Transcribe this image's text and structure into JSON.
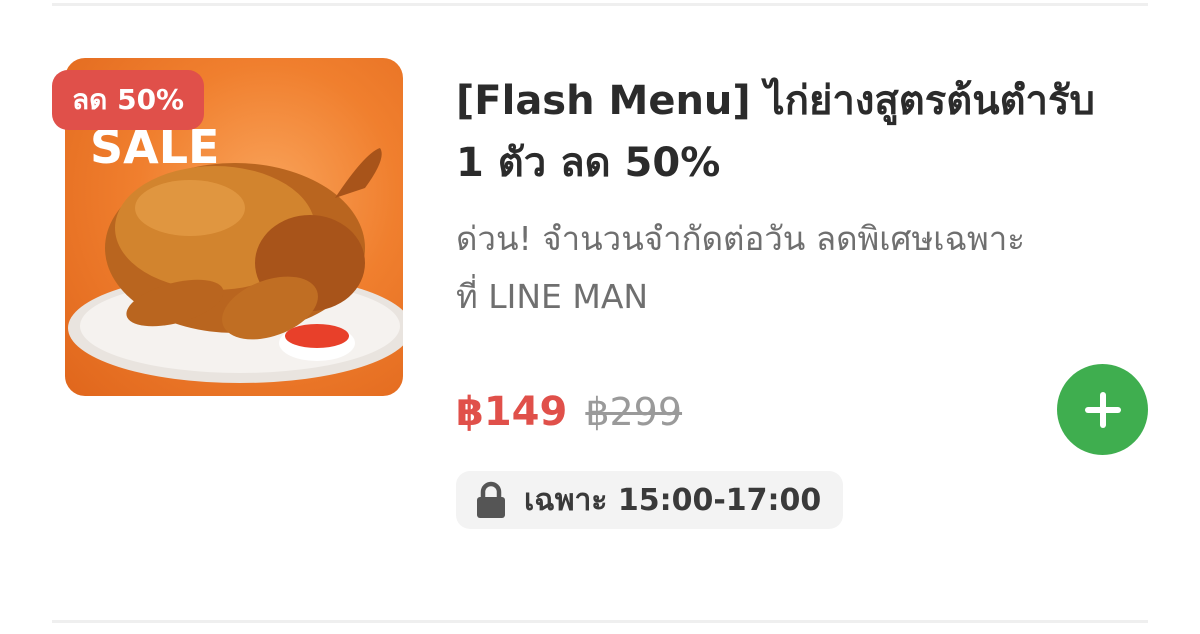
{
  "menu_item": {
    "discount_badge": "ลด 50%",
    "title_line1": "[Flash Menu] ไก่ย่างสูตรต้นตำรับ",
    "title_line2": "1 ตัว ลด 50%",
    "description_line1": "ด่วน! จำนวนจำกัดต่อวัน ลดพิเศษเฉพาะ",
    "description_line2": "ที่ LINE MAN",
    "price_current": "฿149",
    "price_original": "฿299",
    "availability": "เฉพาะ 15:00-17:00",
    "image_text": "SALE"
  },
  "icons": {
    "add": "plus-icon",
    "availability": "lock-icon"
  },
  "colors": {
    "price_red": "#e0504a",
    "add_green": "#3fae4f",
    "badge_red": "#e0504a",
    "image_orange": "#f07f2e"
  }
}
